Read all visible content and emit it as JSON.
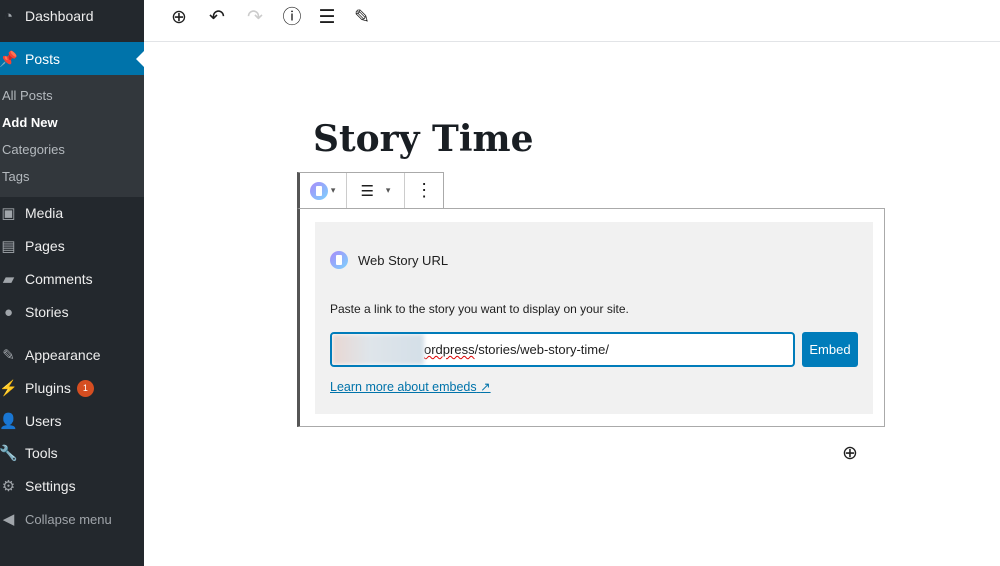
{
  "sidebar": {
    "items": [
      {
        "label": "Dashboard",
        "icon": "dashboard-icon"
      },
      {
        "label": "Posts",
        "icon": "pin-icon"
      },
      {
        "label": "Media",
        "icon": "media-icon"
      },
      {
        "label": "Pages",
        "icon": "pages-icon"
      },
      {
        "label": "Comments",
        "icon": "comment-icon"
      },
      {
        "label": "Stories",
        "icon": "stories-icon"
      },
      {
        "label": "Appearance",
        "icon": "brush-icon"
      },
      {
        "label": "Plugins",
        "icon": "plugin-icon",
        "badge": "1"
      },
      {
        "label": "Users",
        "icon": "user-icon"
      },
      {
        "label": "Tools",
        "icon": "wrench-icon"
      },
      {
        "label": "Settings",
        "icon": "settings-icon"
      }
    ],
    "posts_sub": [
      "All Posts",
      "Add New",
      "Categories",
      "Tags"
    ],
    "collapse": "Collapse menu"
  },
  "editor": {
    "title": "Story Time",
    "block": {
      "label": "Web Story URL",
      "description": "Paste a link to the story you want to display on your site.",
      "url_visible_prefix": "ordpress",
      "url_visible_rest": "/stories/web-story-time/",
      "embed_button": "Embed",
      "learn_more": "Learn more about embeds"
    }
  },
  "colors": {
    "accent": "#0073aa",
    "sidebar": "#23282d",
    "badge": "#d54e21"
  }
}
